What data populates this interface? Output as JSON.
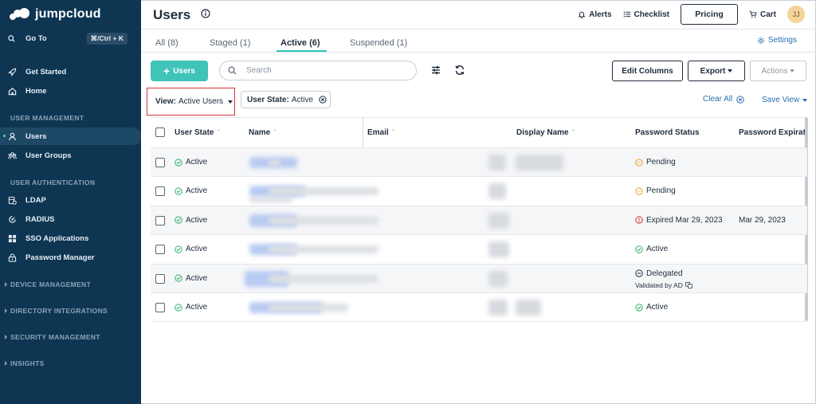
{
  "sidebar": {
    "logo": "jumpcloud",
    "goto_label": "Go To",
    "goto_shortcut": "⌘/Ctrl + K",
    "items": {
      "get_started": "Get Started",
      "home": "Home",
      "users": "Users",
      "user_groups": "User Groups",
      "ldap": "LDAP",
      "radius": "RADIUS",
      "sso": "SSO Applications",
      "password_manager": "Password Manager"
    },
    "sections": {
      "user_management": "USER MANAGEMENT",
      "user_authentication": "USER AUTHENTICATION",
      "device_management": "DEVICE MANAGEMENT",
      "directory_integrations": "DIRECTORY INTEGRATIONS",
      "security_management": "SECURITY MANAGEMENT",
      "insights": "INSIGHTS"
    },
    "colors": {
      "bg": "#0e3652",
      "active_bg": "#1d4866",
      "accent": "#4fd1c5"
    }
  },
  "header": {
    "title": "Users",
    "alerts": "Alerts",
    "checklist": "Checklist",
    "pricing": "Pricing",
    "cart": "Cart",
    "avatar_initials": "JJ"
  },
  "tabs": {
    "all": "All (8)",
    "staged": "Staged (1)",
    "active": "Active (6)",
    "suspended": "Suspended (1)",
    "settings": "Settings"
  },
  "toolbar": {
    "add_users": "Users",
    "search_placeholder": "Search",
    "edit_columns": "Edit Columns",
    "export": "Export",
    "actions": "Actions"
  },
  "filters": {
    "view_label": "View:",
    "view_value": "Active Users",
    "chip_label": "User State:",
    "chip_value": "Active",
    "clear_all": "Clear All",
    "save_view": "Save View"
  },
  "table": {
    "headers": {
      "user_state": "User State",
      "name": "Name",
      "email": "Email",
      "display_name": "Display Name",
      "password_status": "Password Status",
      "password_expiration": "Password Expiratio"
    },
    "rows": [
      {
        "state": "Active",
        "pw_status": "Pending",
        "pw_icon": "pending",
        "pw_sub": "",
        "pw_exp": ""
      },
      {
        "state": "Active",
        "pw_status": "Pending",
        "pw_icon": "pending",
        "pw_sub": "",
        "pw_exp": ""
      },
      {
        "state": "Active",
        "pw_status": "Expired Mar 29, 2023",
        "pw_icon": "expired",
        "pw_sub": "",
        "pw_exp": "Mar 29, 2023"
      },
      {
        "state": "Active",
        "pw_status": "Active",
        "pw_icon": "active",
        "pw_sub": "",
        "pw_exp": ""
      },
      {
        "state": "Active",
        "pw_status": "Delegated",
        "pw_icon": "delegated",
        "pw_sub": "Validated by AD",
        "pw_exp": ""
      },
      {
        "state": "Active",
        "pw_status": "Active",
        "pw_icon": "active",
        "pw_sub": "",
        "pw_exp": ""
      }
    ]
  },
  "colors": {
    "teal": "#40c3b8",
    "link": "#2a6fb0",
    "highlight_red": "#d6333a",
    "active_green": "#2fb36b",
    "pending_orange": "#f0a023",
    "expired_red": "#d9363e"
  }
}
